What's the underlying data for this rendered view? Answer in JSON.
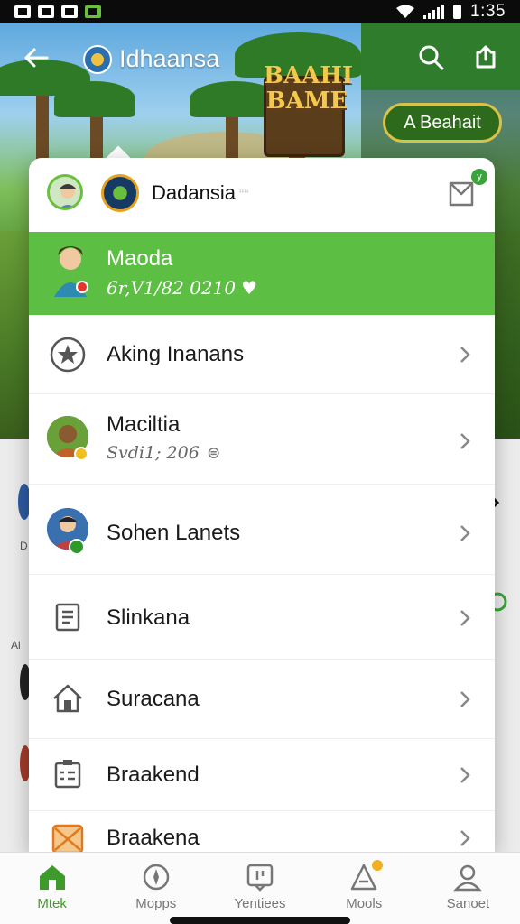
{
  "status_bar": {
    "time": "1:35"
  },
  "app_bar": {
    "title": "Idhaansa"
  },
  "hero": {
    "sign_text": "BAAHI BAME",
    "pill_button": "A Beahait"
  },
  "menu": {
    "header": {
      "title": "Dadansia",
      "title_suffix": "““",
      "badge": "y"
    },
    "active_item": {
      "name": "Maoda",
      "subtitle": "6r,V1/82 0210"
    },
    "items": [
      {
        "label": "Aking Inanans"
      },
      {
        "label": "Maciltia",
        "subtitle": "Svdi1; 206"
      },
      {
        "label": "Sohen Lanets"
      },
      {
        "label": "Slinkana"
      },
      {
        "label": "Suracana"
      },
      {
        "label": "Braakend"
      },
      {
        "label": "Braakena"
      }
    ]
  },
  "bottom_nav": {
    "items": [
      {
        "label": "Mtek"
      },
      {
        "label": "Mopps"
      },
      {
        "label": "Yentiees"
      },
      {
        "label": "Mools"
      },
      {
        "label": "Sanoet"
      }
    ]
  },
  "colors": {
    "accent_green": "#5cbf44",
    "nav_active": "#3f9a2c",
    "dark_green": "#2f7d2c"
  }
}
